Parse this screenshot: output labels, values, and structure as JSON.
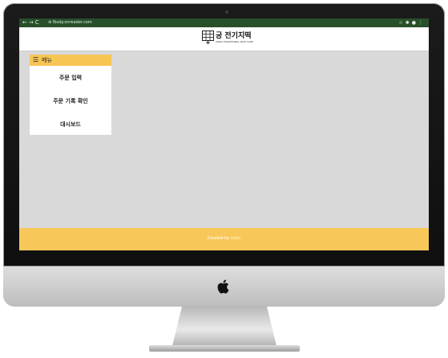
{
  "browser": {
    "url": "fbsdy.onreader.com",
    "tool_icons": [
      "star-icon",
      "extension-icon",
      "profile-icon",
      "menu-dots-icon"
    ]
  },
  "site": {
    "logo_title": "궁 전기지떡",
    "logo_subtitle": "SONG TRADITIONAL RICE CAKE"
  },
  "sidebar": {
    "menu_icon": "☰",
    "menu_label": "메뉴",
    "items": [
      {
        "label": "주문 입력"
      },
      {
        "label": "주문 기록 확인"
      },
      {
        "label": "대시보드"
      }
    ]
  },
  "footer": {
    "created_by": "Created by",
    "author": "ssjko"
  },
  "colors": {
    "browser_bar": "#27502a",
    "accent": "#f7c554",
    "content_bg": "#d9d9d9"
  }
}
